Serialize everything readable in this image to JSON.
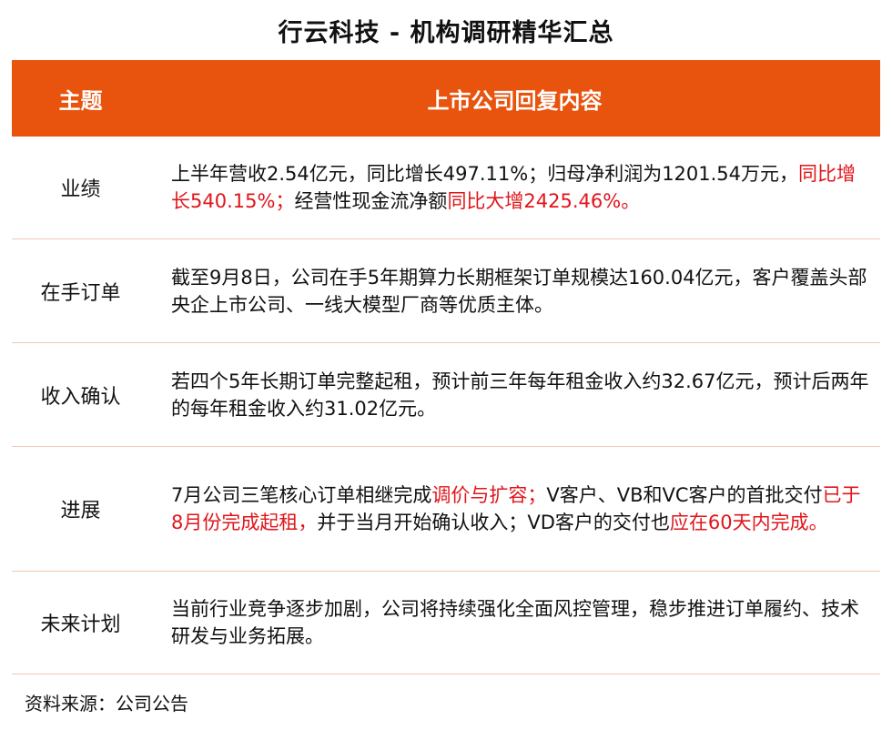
{
  "title": "行云科技 - 机构调研精华汇总",
  "header": {
    "col1": "主题",
    "col2": "上市公司回复内容"
  },
  "rows": [
    {
      "topic": "业绩",
      "segments": [
        {
          "text": "上半年营收2.54亿元，同比增长497.11%；归母净利润为1201.54万元，",
          "highlight": false
        },
        {
          "text": "同比增长540.15%；",
          "highlight": true
        },
        {
          "text": "经营性现金流净额",
          "highlight": false
        },
        {
          "text": "同比大增2425.46%。",
          "highlight": true
        }
      ]
    },
    {
      "topic": "在手订单",
      "segments": [
        {
          "text": "截至9月8日，公司在手5年期算力长期框架订单规模达160.04亿元，客户覆盖头部央企上市公司、一线大模型厂商等优质主体。",
          "highlight": false
        }
      ]
    },
    {
      "topic": "收入确认",
      "segments": [
        {
          "text": "若四个5年长期订单完整起租，预计前三年每年租金收入约32.67亿元，预计后两年的每年租金收入约31.02亿元。",
          "highlight": false
        }
      ]
    },
    {
      "topic": "进展",
      "segments": [
        {
          "text": "7月公司三笔核心订单相继完成",
          "highlight": false
        },
        {
          "text": "调价与扩容；",
          "highlight": true
        },
        {
          "text": "V客户、VB和VC客户的首批交付",
          "highlight": false
        },
        {
          "text": "已于8月份完成起租，",
          "highlight": true
        },
        {
          "text": "并于当月开始确认收入；VD客户的交付也",
          "highlight": false
        },
        {
          "text": "应在60天内完成。",
          "highlight": true
        }
      ]
    },
    {
      "topic": "未来计划",
      "segments": [
        {
          "text": "当前行业竞争逐步加剧，公司将持续强化全面风控管理，稳步推进订单履约、技术研发与业务拓展。",
          "highlight": false
        }
      ]
    }
  ],
  "source": "资料来源：公司公告",
  "colors": {
    "header_bg": "#e8530e",
    "highlight": "#e0151b",
    "row_border": "#f3c8b0"
  }
}
